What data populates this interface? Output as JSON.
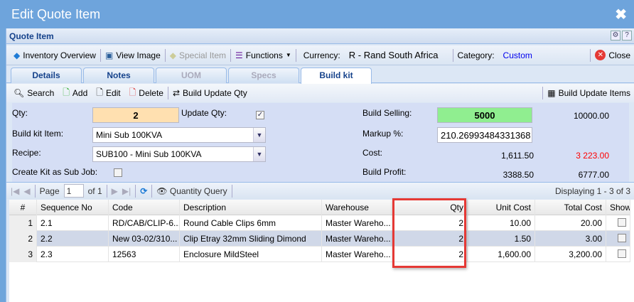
{
  "window": {
    "title": "Edit Quote Item",
    "close": "✖"
  },
  "panel": {
    "title": "Quote Item",
    "gear": "⚙",
    "help": "?"
  },
  "toolbar": {
    "inventory_overview": "Inventory Overview",
    "view_image": "View Image",
    "special_item": "Special Item",
    "functions": "Functions",
    "currency_label": "Currency:",
    "currency_value": "R - Rand South Africa",
    "category_label": "Category:",
    "category_value": "Custom",
    "close": "Close"
  },
  "tabs": [
    {
      "label": "Details"
    },
    {
      "label": "Notes"
    },
    {
      "label": "UOM"
    },
    {
      "label": "Specs"
    },
    {
      "label": "Build kit"
    }
  ],
  "buildbar": {
    "search": "Search",
    "add": "Add",
    "edit": "Edit",
    "delete": "Delete",
    "build_update_qty": "Build Update Qty",
    "build_update_items": "Build Update Items"
  },
  "form": {
    "qty_label": "Qty:",
    "qty_value": "2",
    "update_qty_label": "Update Qty:",
    "update_qty_checked": true,
    "kit_item_label": "Build kit Item:",
    "kit_item_value": "Mini Sub 100KVA",
    "recipe_label": "Recipe:",
    "recipe_value": "SUB100 - Mini Sub 100KVA",
    "sub_job_label": "Create Kit as Sub Job:",
    "sub_job_checked": false,
    "build_selling_label": "Build Selling:",
    "build_selling_value": "5000",
    "build_selling_total": "10000.00",
    "markup_label": "Markup %:",
    "markup_value": "210.26993484331368",
    "cost_label": "Cost:",
    "cost_value": "1,611.50",
    "cost_total": "3 223.00",
    "profit_label": "Build Profit:",
    "profit_value": "3388.50",
    "profit_total": "6777.00"
  },
  "pager": {
    "page_label": "Page",
    "page_value": "1",
    "of": "of 1",
    "quantity_query": "Quantity Query",
    "displaying": "Displaying 1 - 3 of 3"
  },
  "grid": {
    "columns": [
      "#",
      "Sequence No",
      "Code",
      "Description",
      "Warehouse",
      "Qty",
      "Unit Cost",
      "Total Cost",
      "Show"
    ],
    "rows": [
      [
        "1",
        "2.1",
        "RD/CAB/CLIP-6...",
        "Round Cable Clips 6mm",
        "Master Wareho...",
        "2",
        "10.00",
        "20.00"
      ],
      [
        "2",
        "2.2",
        "New 03-02/310...",
        "Clip Etray 32mm Sliding Dimond",
        "Master Wareho...",
        "2",
        "1.50",
        "3.00"
      ],
      [
        "3",
        "2.3",
        "12563",
        "Enclosure MildSteel",
        "Master Wareho...",
        "2",
        "1,600.00",
        "3,200.00"
      ]
    ]
  },
  "colors": {
    "qty_bg": "#ffe0b0",
    "selling_bg": "#90ee90",
    "cost_total": "#ff0000",
    "highlight": "#e53935"
  }
}
